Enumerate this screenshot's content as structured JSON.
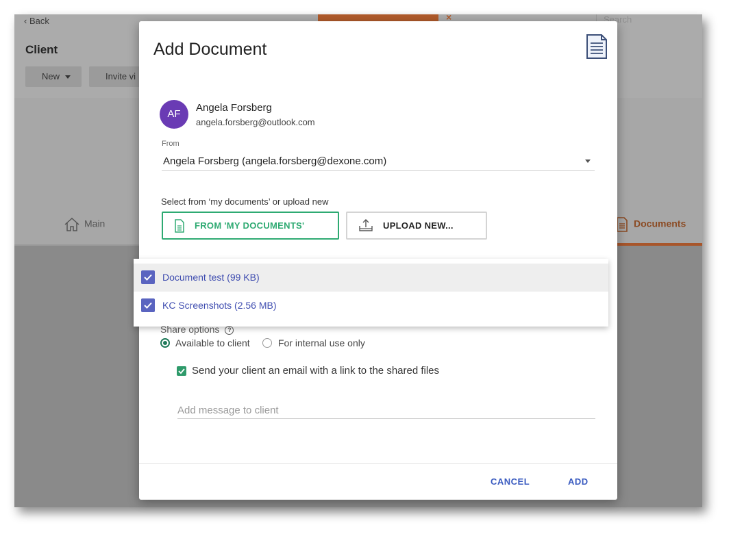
{
  "background": {
    "back_label": "Back",
    "client_title": "Client",
    "new_button": "New",
    "invite_button": "Invite vi",
    "search_placeholder": "Search",
    "tabs": {
      "main": "Main",
      "documents": "Documents"
    },
    "accent_color": "#a8562b"
  },
  "modal": {
    "title": "Add Document",
    "icon": "document-icon",
    "client": {
      "initials": "AF",
      "name": "Angela Forsberg",
      "email": "angela.forsberg@outlook.com",
      "avatar_color": "#6a3bb4"
    },
    "from": {
      "label": "From",
      "value": "Angela Forsberg (angela.forsberg@dexone.com)"
    },
    "select_label": "Select from ‘my documents’ or upload new",
    "btn_my_documents": "FROM 'MY DOCUMENTS'",
    "btn_upload": "UPLOAD NEW...",
    "documents": [
      {
        "name": "Document test (99 KB)",
        "checked": true
      },
      {
        "name": "KC Screenshots (2.56 MB)",
        "checked": true
      }
    ],
    "share": {
      "label": "Share options",
      "help_icon": "?",
      "option_client": "Available to client",
      "option_internal": "For internal use only",
      "selected": "Available to client",
      "email_label": "Send your client an email with a link to the shared files",
      "email_checked": true
    },
    "message_placeholder": "Add message to client",
    "cancel_label": "CANCEL",
    "add_label": "ADD",
    "accent_green": "#2eaa72",
    "link_blue": "#3a5bc0"
  }
}
